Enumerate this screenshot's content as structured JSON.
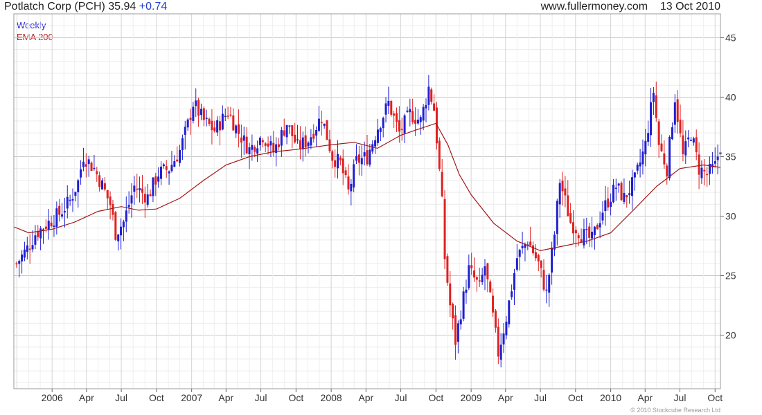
{
  "header": {
    "title": "Potlatch Corp (PCH)",
    "price": "35.94",
    "change": "+0.74",
    "source": "www.fullermoney.com",
    "date": "13 Oct 2010"
  },
  "legend": {
    "weekly": "Weekly",
    "ema": "EMA 200"
  },
  "copyright": "© 2010 Stockcube Research Ltd",
  "colors": {
    "up": "#1f1fd1",
    "down": "#e02020",
    "ema": "#a01818",
    "grid": "#d8d8d8",
    "axis": "#666666"
  },
  "chart_data": {
    "type": "candlestick",
    "title": "Potlatch Corp (PCH)",
    "interval": "Weekly",
    "x_range": [
      "2005-09-23",
      "2010-10-15"
    ],
    "ylim": [
      15.5,
      47
    ],
    "y_ticks": [
      20,
      25,
      30,
      35,
      40,
      45
    ],
    "x_ticks": [
      {
        "date": "2006-01-01",
        "label": "2006"
      },
      {
        "date": "2006-04-01",
        "label": "Apr"
      },
      {
        "date": "2006-07-01",
        "label": "Jul"
      },
      {
        "date": "2006-10-01",
        "label": "Oct"
      },
      {
        "date": "2007-01-01",
        "label": "2007"
      },
      {
        "date": "2007-04-01",
        "label": "Apr"
      },
      {
        "date": "2007-07-01",
        "label": "Jul"
      },
      {
        "date": "2007-10-01",
        "label": "Oct"
      },
      {
        "date": "2008-01-01",
        "label": "2008"
      },
      {
        "date": "2008-04-01",
        "label": "Apr"
      },
      {
        "date": "2008-07-01",
        "label": "Jul"
      },
      {
        "date": "2008-10-01",
        "label": "Oct"
      },
      {
        "date": "2009-01-01",
        "label": "2009"
      },
      {
        "date": "2009-04-01",
        "label": "Apr"
      },
      {
        "date": "2009-07-01",
        "label": "Jul"
      },
      {
        "date": "2009-10-01",
        "label": "Oct"
      },
      {
        "date": "2010-01-01",
        "label": "2010"
      },
      {
        "date": "2010-04-01",
        "label": "Apr"
      },
      {
        "date": "2010-07-01",
        "label": "Jul"
      },
      {
        "date": "2010-10-01",
        "label": "Oct"
      }
    ],
    "weekly_close": [
      [
        "2005-09-30",
        26.0
      ],
      [
        "2005-10-28",
        27.3
      ],
      [
        "2005-11-18",
        28.5
      ],
      [
        "2005-12-16",
        29.3
      ],
      [
        "2006-01-20",
        30.2
      ],
      [
        "2006-02-17",
        31.3
      ],
      [
        "2006-03-10",
        32.9
      ],
      [
        "2006-03-24",
        35.1
      ],
      [
        "2006-04-21",
        34.0
      ],
      [
        "2006-05-12",
        32.6
      ],
      [
        "2006-06-02",
        31.0
      ],
      [
        "2006-06-16",
        28.6
      ],
      [
        "2006-07-07",
        29.5
      ],
      [
        "2006-08-04",
        32.5
      ],
      [
        "2006-09-08",
        31.6
      ],
      [
        "2006-10-06",
        33.6
      ],
      [
        "2006-11-03",
        34.0
      ],
      [
        "2006-12-01",
        35.5
      ],
      [
        "2006-12-22",
        37.7
      ],
      [
        "2007-01-05",
        39.5
      ],
      [
        "2007-02-02",
        38.0
      ],
      [
        "2007-03-02",
        37.2
      ],
      [
        "2007-04-06",
        38.8
      ],
      [
        "2007-05-04",
        37.0
      ],
      [
        "2007-06-01",
        35.6
      ],
      [
        "2007-07-06",
        36.8
      ],
      [
        "2007-08-03",
        35.4
      ],
      [
        "2007-09-07",
        37.8
      ],
      [
        "2007-10-05",
        35.8
      ],
      [
        "2007-11-02",
        36.4
      ],
      [
        "2007-12-07",
        38.4
      ],
      [
        "2008-01-04",
        35.0
      ],
      [
        "2008-01-25",
        34.4
      ],
      [
        "2008-02-15",
        32.0
      ],
      [
        "2008-03-07",
        34.6
      ],
      [
        "2008-04-04",
        35.0
      ],
      [
        "2008-05-02",
        37.5
      ],
      [
        "2008-05-30",
        39.5
      ],
      [
        "2008-06-27",
        37.0
      ],
      [
        "2008-07-25",
        38.6
      ],
      [
        "2008-08-22",
        38.0
      ],
      [
        "2008-09-12",
        40.8
      ],
      [
        "2008-09-26",
        39.0
      ],
      [
        "2008-10-03",
        36.5
      ],
      [
        "2008-10-17",
        31.0
      ],
      [
        "2008-10-24",
        26.5
      ],
      [
        "2008-11-07",
        22.5
      ],
      [
        "2008-11-21",
        19.5
      ],
      [
        "2008-12-05",
        22.0
      ],
      [
        "2008-12-26",
        25.5
      ],
      [
        "2009-01-23",
        24.0
      ],
      [
        "2009-02-06",
        25.8
      ],
      [
        "2009-02-27",
        21.5
      ],
      [
        "2009-03-13",
        18.5
      ],
      [
        "2009-04-03",
        21.5
      ],
      [
        "2009-05-01",
        26.5
      ],
      [
        "2009-05-29",
        28.0
      ],
      [
        "2009-06-26",
        26.0
      ],
      [
        "2009-07-17",
        23.5
      ],
      [
        "2009-08-07",
        28.5
      ],
      [
        "2009-08-21",
        33.0
      ],
      [
        "2009-09-18",
        29.5
      ],
      [
        "2009-10-16",
        28.5
      ],
      [
        "2009-11-13",
        28.0
      ],
      [
        "2009-12-11",
        30.5
      ],
      [
        "2010-01-15",
        32.5
      ],
      [
        "2010-02-05",
        31.5
      ],
      [
        "2010-03-05",
        33.0
      ],
      [
        "2010-04-02",
        36.0
      ],
      [
        "2010-04-23",
        40.5
      ],
      [
        "2010-05-07",
        36.0
      ],
      [
        "2010-05-28",
        34.0
      ],
      [
        "2010-06-18",
        40.0
      ],
      [
        "2010-07-09",
        35.0
      ],
      [
        "2010-07-30",
        37.0
      ],
      [
        "2010-08-20",
        34.0
      ],
      [
        "2010-09-10",
        33.5
      ],
      [
        "2010-10-01",
        34.2
      ],
      [
        "2010-10-15",
        35.94
      ]
    ],
    "ema_200": [
      [
        "2005-09-23",
        29.1
      ],
      [
        "2005-11-01",
        28.6
      ],
      [
        "2006-01-01",
        28.9
      ],
      [
        "2006-03-01",
        29.5
      ],
      [
        "2006-05-01",
        30.4
      ],
      [
        "2006-07-01",
        30.8
      ],
      [
        "2006-08-15",
        30.5
      ],
      [
        "2006-10-01",
        30.6
      ],
      [
        "2006-12-01",
        31.5
      ],
      [
        "2007-02-01",
        33.0
      ],
      [
        "2007-04-01",
        34.3
      ],
      [
        "2007-06-01",
        35.0
      ],
      [
        "2007-08-01",
        35.4
      ],
      [
        "2007-10-01",
        35.6
      ],
      [
        "2008-01-01",
        36.0
      ],
      [
        "2008-03-01",
        36.2
      ],
      [
        "2008-05-01",
        35.7
      ],
      [
        "2008-07-01",
        36.8
      ],
      [
        "2008-08-15",
        37.3
      ],
      [
        "2008-10-01",
        37.8
      ],
      [
        "2008-11-01",
        36.0
      ],
      [
        "2008-12-01",
        33.5
      ],
      [
        "2009-01-01",
        31.8
      ],
      [
        "2009-03-01",
        29.4
      ],
      [
        "2009-05-01",
        27.9
      ],
      [
        "2009-07-01",
        27.1
      ],
      [
        "2009-09-01",
        27.5
      ],
      [
        "2009-11-01",
        27.9
      ],
      [
        "2010-01-01",
        28.6
      ],
      [
        "2010-03-01",
        30.5
      ],
      [
        "2010-05-01",
        32.5
      ],
      [
        "2010-07-01",
        34.0
      ],
      [
        "2010-09-01",
        34.3
      ],
      [
        "2010-10-15",
        34.1
      ]
    ]
  }
}
